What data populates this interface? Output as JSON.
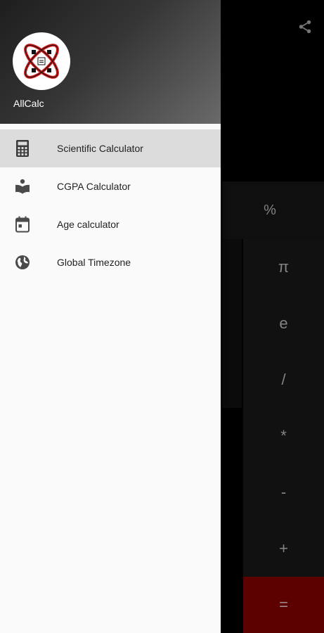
{
  "app": {
    "name": "AllCalc"
  },
  "drawer": {
    "items": [
      {
        "label": "Scientific Calculator",
        "icon": "calculator-icon",
        "active": true
      },
      {
        "label": "CGPA Calculator",
        "icon": "reading-book-icon",
        "active": false
      },
      {
        "label": "Age calculator",
        "icon": "calendar-icon",
        "active": false
      },
      {
        "label": "Global Timezone",
        "icon": "globe-icon",
        "active": false
      }
    ]
  },
  "calculator": {
    "percent": "%",
    "operators": [
      "π",
      "e",
      "/",
      "*",
      "-",
      "+"
    ],
    "equals": "="
  },
  "colors": {
    "equals_bg": "#6d0000",
    "drawer_bg": "#fafafa",
    "active_item_bg": "#dcdcdc"
  }
}
